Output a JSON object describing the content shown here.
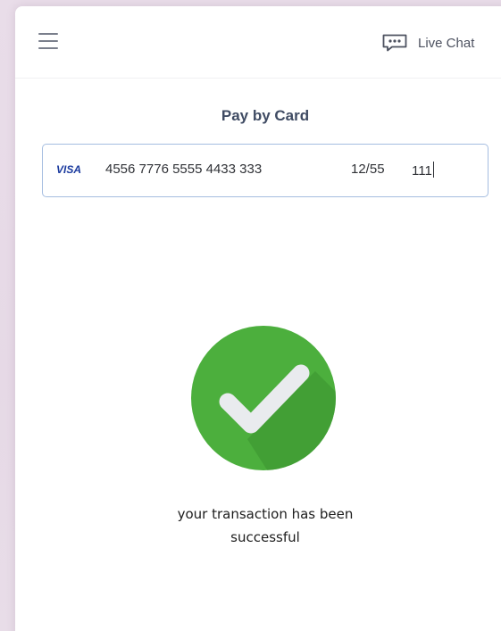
{
  "header": {
    "menu_icon": "hamburger-menu-icon",
    "chat_icon": "chat-bubble-icon",
    "live_chat_label": "Live Chat"
  },
  "payment": {
    "title": "Pay by Card",
    "card_brand": "VISA",
    "card_number": "4556 7776 5555 4433 333",
    "expiry": "12/55",
    "cvc": "111"
  },
  "result": {
    "icon": "checkmark-success-icon",
    "icon_color": "#4caf3d",
    "message_line1": "your transaction has been",
    "message_line2": "successful"
  },
  "colors": {
    "background": "#e8dce8",
    "title": "#3f4b63",
    "field_border": "#a5bde0",
    "visa_blue": "#1a3a9e"
  }
}
